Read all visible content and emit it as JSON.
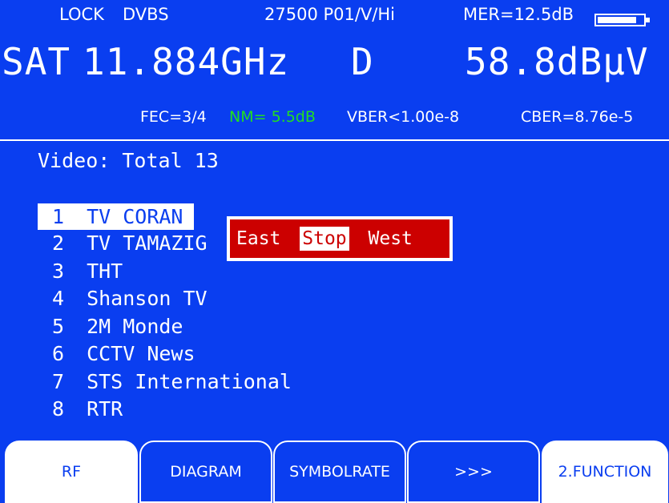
{
  "status": {
    "lock": "LOCK",
    "standard": "DVBS",
    "transponder": "27500 P01/V/Hi",
    "mer": "MER=12.5dB",
    "battery_level": 0.85
  },
  "frequency": {
    "band": "SAT",
    "value": "11.884GHz",
    "suffix": "D",
    "level": "58.8dBµV"
  },
  "metrics": {
    "fec": "FEC=3/4",
    "nm": "NM= 5.5dB",
    "vber": "VBER<1.00e-8",
    "cber": "CBER=8.76e-5"
  },
  "video": {
    "title": "Video:  Total 13",
    "channels": [
      {
        "num": "1",
        "name": "TV CORAN"
      },
      {
        "num": "2",
        "name": "TV TAMAZIG"
      },
      {
        "num": "3",
        "name": "THT"
      },
      {
        "num": "4",
        "name": "Shanson TV"
      },
      {
        "num": "5",
        "name": "2M Monde"
      },
      {
        "num": "6",
        "name": "CCTV News"
      },
      {
        "num": "7",
        "name": "STS International"
      },
      {
        "num": "8",
        "name": "RTR"
      }
    ]
  },
  "popup": {
    "east": "East",
    "stop": "Stop",
    "west": "West"
  },
  "softkeys": [
    "RF",
    "DIAGRAM",
    "SYMBOLRATE",
    ">>>",
    "2.FUNCTION"
  ],
  "colors": {
    "background": "#0a3ef0",
    "nm_highlight": "#22dd22",
    "popup": "#cc0000"
  }
}
